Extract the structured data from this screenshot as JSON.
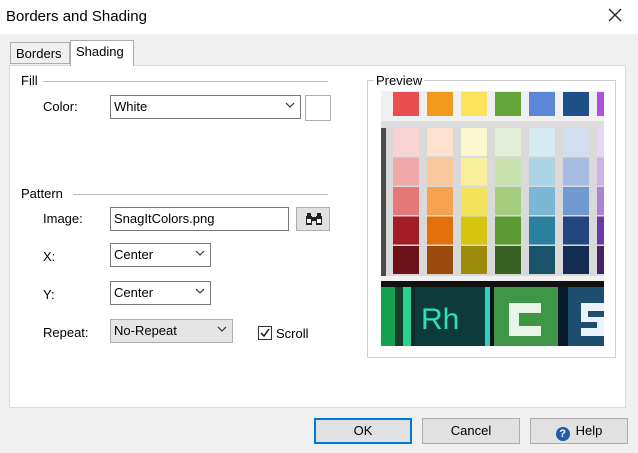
{
  "window": {
    "title": "Borders and Shading"
  },
  "tabs": [
    {
      "label": "Borders"
    },
    {
      "label": "Shading"
    }
  ],
  "fill": {
    "group_label": "Fill",
    "color_label": "Color:",
    "color_value": "White"
  },
  "pattern": {
    "group_label": "Pattern",
    "image_label": "Image:",
    "image_value": "SnagItColors.png",
    "x_label": "X:",
    "x_value": "Center",
    "y_label": "Y:",
    "y_value": "Center",
    "repeat_label": "Repeat:",
    "repeat_value": "No-Repeat",
    "scroll_label": "Scroll",
    "scroll_checked": true
  },
  "preview": {
    "label": "Preview",
    "top_row_colors": [
      "#e94f4f",
      "#f39a1c",
      "#fde25a",
      "#64a539",
      "#5b87d6",
      "#1e4f88",
      "#b04fe0"
    ],
    "shade_columns": [
      [
        "#f8d3d3",
        "#f1a8a8",
        "#e67878",
        "#a41c26",
        "#6e121a"
      ],
      [
        "#fde3cf",
        "#fbc89d",
        "#f7a24f",
        "#e36f0d",
        "#9a4a0a"
      ],
      [
        "#fbf7cf",
        "#f8f09b",
        "#f1e45a",
        "#d6c40e",
        "#9b8c0b"
      ],
      [
        "#e3efd6",
        "#c8e1ad",
        "#a4cd7e",
        "#5c9b34",
        "#386222"
      ],
      [
        "#d6eaf2",
        "#acd3e6",
        "#7bb8d6",
        "#2b7fa0",
        "#1b5169"
      ],
      [
        "#d2def0",
        "#a6bde3",
        "#7098d1",
        "#23467e",
        "#142c52"
      ],
      [
        "#e5d8f2",
        "#ccb2e6",
        "#aa84d6",
        "#6b3aa3",
        "#432268"
      ]
    ],
    "app_tiles": [
      {
        "text": "Rh",
        "bg": "#0c3b3a",
        "fg": "#2fe0b5"
      }
    ]
  },
  "buttons": {
    "ok": "OK",
    "cancel": "Cancel",
    "help": "Help"
  }
}
